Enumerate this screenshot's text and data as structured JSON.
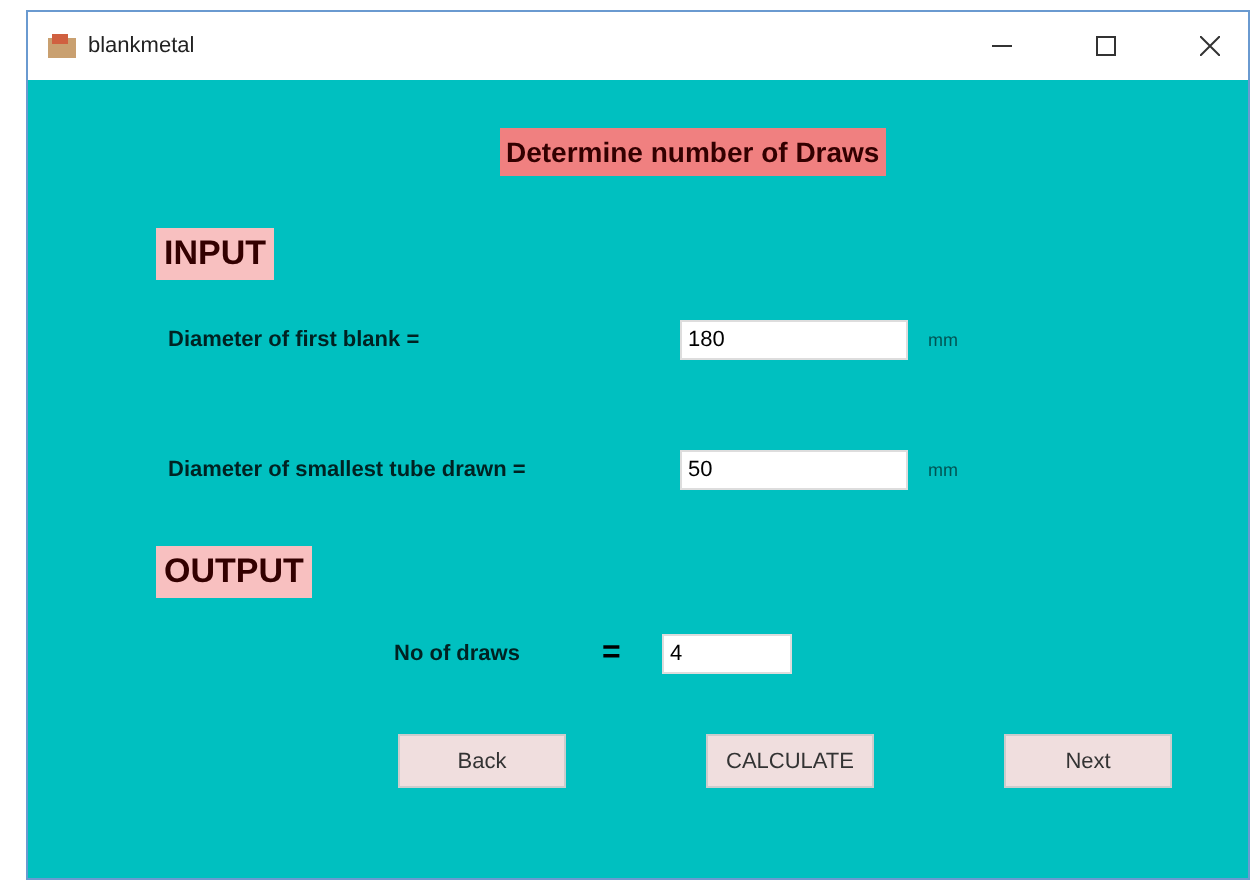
{
  "window": {
    "title": "blankmetal"
  },
  "heading": "Determine number of Draws",
  "input_section": {
    "title": "INPUT",
    "fields": [
      {
        "label": "Diameter of first blank =",
        "value": "180",
        "unit": "mm"
      },
      {
        "label": "Diameter of smallest  tube drawn =",
        "value": "50",
        "unit": "mm"
      }
    ]
  },
  "output_section": {
    "title": "OUTPUT",
    "label": "No of draws",
    "equals": "=",
    "value": "4"
  },
  "buttons": [
    "Back",
    "CALCULATE",
    "Next"
  ]
}
